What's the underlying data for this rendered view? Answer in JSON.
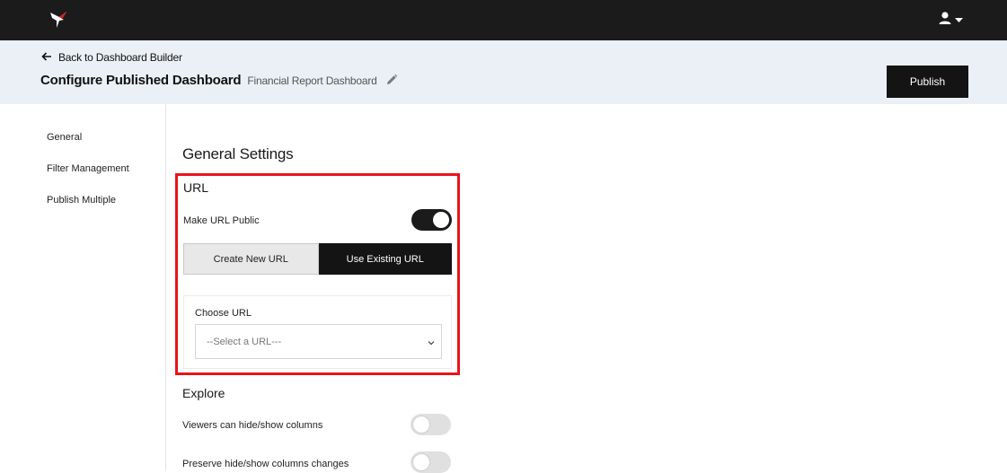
{
  "topbar": {
    "logo_icon": "bird-logo-icon",
    "user_icon": "user-icon",
    "caret_icon": "caret-down-icon"
  },
  "header": {
    "back_label": "Back to Dashboard Builder",
    "title": "Configure Published Dashboard",
    "dashboard_name": "Financial Report Dashboard",
    "publish_label": "Publish"
  },
  "sidebar": {
    "items": [
      {
        "label": "General"
      },
      {
        "label": "Filter Management"
      },
      {
        "label": "Publish Multiple"
      }
    ]
  },
  "main": {
    "section_title": "General Settings",
    "url": {
      "heading": "URL",
      "make_public_label": "Make URL Public",
      "make_public_on": true,
      "tabs": [
        {
          "label": "Create New URL",
          "active": false
        },
        {
          "label": "Use Existing URL",
          "active": true
        }
      ],
      "choose_label": "Choose URL",
      "select_value": "--Select a URL---"
    },
    "explore": {
      "heading": "Explore",
      "options": [
        {
          "label": "Viewers can hide/show columns",
          "on": false
        },
        {
          "label": "Preserve hide/show columns changes",
          "on": false
        }
      ]
    }
  },
  "colors": {
    "highlight": "#e8141c",
    "dark": "#1b1b1b",
    "header_bg": "#eaf0f5"
  }
}
